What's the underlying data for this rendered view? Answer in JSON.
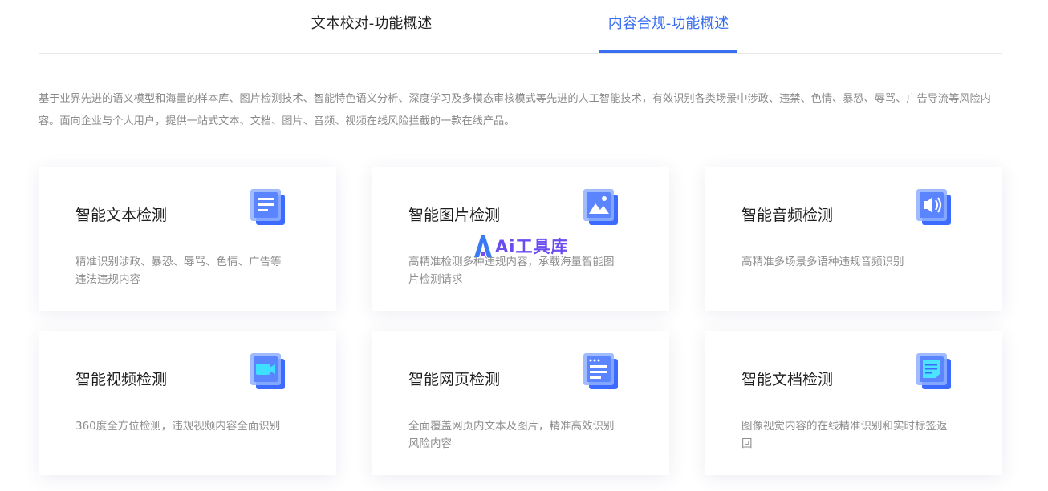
{
  "tabs": [
    {
      "label": "文本校对-功能概述",
      "active": false
    },
    {
      "label": "内容合规-功能概述",
      "active": true
    }
  ],
  "description": "基于业界先进的语义模型和海量的样本库、图片检测技术、智能特色语义分析、深度学习及多模态审核模式等先进的人工智能技术，有效识别各类场景中涉政、违禁、色情、暴恐、辱骂、广告导流等风险内容。面向企业与个人用户，提供一站式文本、文档、图片、音频、视频在线风险拦截的一款在线产品。",
  "cards": [
    {
      "title": "智能文本检测",
      "text": "精准识别涉政、暴恐、辱骂、色情、广告等违法违规内容",
      "icon": "text-document-icon"
    },
    {
      "title": "智能图片检测",
      "text": "高精准检测多种违规内容，承载海量智能图片检测请求",
      "icon": "image-icon"
    },
    {
      "title": "智能音频检测",
      "text": "高精准多场景多语种违规音频识别",
      "icon": "speaker-icon"
    },
    {
      "title": "智能视频检测",
      "text": "360度全方位检测，违规视频内容全面识别",
      "icon": "video-camera-icon"
    },
    {
      "title": "智能网页检测",
      "text": "全面覆盖网页内文本及图片，精准高效识别风险内容",
      "icon": "webpage-icon"
    },
    {
      "title": "智能文档检测",
      "text": "图像视觉内容的在线精准识别和实时标签返回",
      "icon": "document-note-icon"
    }
  ],
  "watermark": {
    "text": "Ai工具库"
  },
  "colors": {
    "accent": "#3a6ef0",
    "icon_light": "#9fb8ff",
    "icon_dark": "#3e6bff",
    "watermark": "#6b4cf0"
  }
}
